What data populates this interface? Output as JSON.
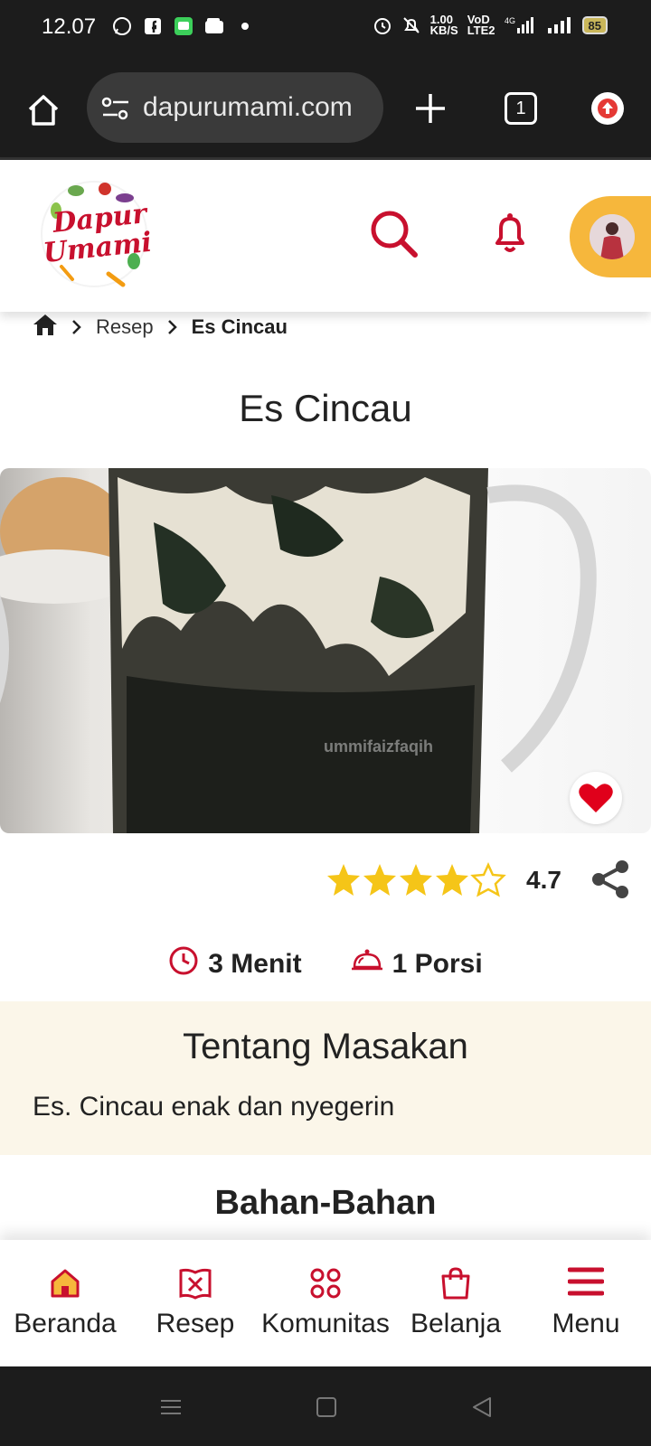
{
  "status_bar": {
    "time": "12.07",
    "network_speed": "1.00\nKB/S",
    "volte": "VoD\nLTE2",
    "signal_type": "4G",
    "battery": "85"
  },
  "browser": {
    "url": "dapurumami.com",
    "tab_count": "1"
  },
  "site_header": {
    "logo_line1": "Dapur",
    "logo_line2": "Umami"
  },
  "breadcrumb": {
    "level1": "Resep",
    "current": "Es Cincau"
  },
  "recipe": {
    "title": "Es Cincau",
    "image_watermark": "ummifaizfaqih",
    "rating": "4.7",
    "rating_stars": 4,
    "rating_max": 5,
    "time": "3 Menit",
    "portions": "1 Porsi"
  },
  "about": {
    "title": "Tentang Masakan",
    "text": "Es. Cincau enak dan nyegerin"
  },
  "ingredients": {
    "title": "Bahan-Bahan"
  },
  "bottom_nav": {
    "items": [
      {
        "label": "Beranda",
        "icon": "home-icon"
      },
      {
        "label": "Resep",
        "icon": "recipe-book-icon"
      },
      {
        "label": "Komunitas",
        "icon": "community-icon"
      },
      {
        "label": "Belanja",
        "icon": "shopping-bag-icon"
      },
      {
        "label": "Menu",
        "icon": "hamburger-menu-icon"
      }
    ]
  },
  "colors": {
    "brand_red": "#c8102e",
    "accent_yellow": "#f6b73c",
    "star_yellow": "#f5c518",
    "about_bg": "#fbf6e9"
  }
}
